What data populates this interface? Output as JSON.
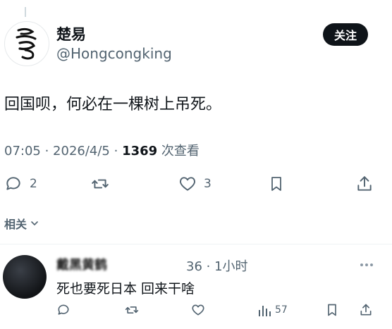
{
  "tweet": {
    "author_name": "楚易",
    "author_handle": "@Hongcongking",
    "follow_label": "关注",
    "text": "回国呗，何必在一棵树上吊死。",
    "time": "07:05",
    "sep1": " · ",
    "date": "2026/4/5",
    "sep2": " · ",
    "views_count": "1369",
    "views_label": " 次查看",
    "reply_count": "2",
    "like_count": "3"
  },
  "related_label": "相关",
  "reply": {
    "author_name": "戴黑黄鹤",
    "time_ago": "36 · 1小时",
    "text": "死也要死日本 回来干啥",
    "views_count": "57"
  },
  "icons": {
    "avatar": "calligraphy-logo",
    "reply": "speech-bubble-icon",
    "retweet": "retweet-icon",
    "like": "heart-icon",
    "bookmark": "bookmark-icon",
    "share": "share-icon",
    "analytics": "bar-chart-icon",
    "more": "more-icon",
    "chevron": "chevron-down-icon"
  },
  "colors": {
    "text": "#0f1419",
    "muted": "#536471",
    "follow_bg": "#0f1419",
    "divider": "#eff3f4"
  }
}
